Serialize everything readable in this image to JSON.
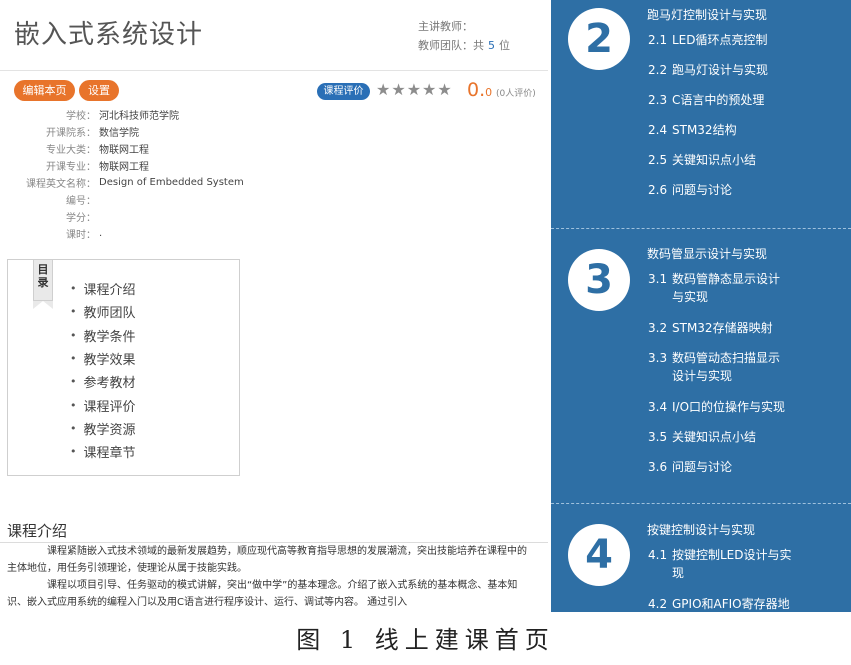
{
  "header": {
    "course_title": "嵌入式系统设计",
    "main_teacher_label": "主讲教师：",
    "team_label": "教师团队：共",
    "team_count": "5",
    "team_unit": "位"
  },
  "actions": {
    "edit_label": "编辑本页",
    "settings_label": "设置"
  },
  "rating": {
    "badge_label": "课程评价",
    "stars": "★★★★★",
    "score": "0.",
    "score_decimal": "0",
    "count_text": "(0人评价)",
    "star_color": "#8d8d8d",
    "score_color": "#e8742b"
  },
  "info": [
    {
      "key": "学校：",
      "value": "河北科技师范学院"
    },
    {
      "key": "开课院系：",
      "value": "数信学院"
    },
    {
      "key": "专业大类：",
      "value": "物联网工程"
    },
    {
      "key": "开课专业：",
      "value": "物联网工程"
    },
    {
      "key": "课程英文名称：",
      "value": "Design of Embedded System"
    },
    {
      "key": "编号：",
      "value": ""
    },
    {
      "key": "学分：",
      "value": ""
    },
    {
      "key": "课时：",
      "value": "."
    }
  ],
  "toc": {
    "ribbon": [
      "目",
      "录"
    ],
    "items": [
      "课程介绍",
      "教师团队",
      "教学条件",
      "教学效果",
      "参考教材",
      "课程评价",
      "教学资源",
      "课程章节"
    ]
  },
  "intro": {
    "heading": "课程介绍",
    "p1": "课程紧随嵌入式技术领域的最新发展趋势，顺应现代高等教育指导思想的发展潮流，突出技能培养在课程中的主体地位，用任务引领理论，使理论从属于技能实践。",
    "p2": "课程以项目引导、任务驱动的模式讲解，突出“做中学”的基本理念。介绍了嵌入式系统的基本概念、基本知识、嵌入式应用系统的编程入门以及用C语言进行程序设计、运行、调试等内容。 通过引入"
  },
  "chapters": [
    {
      "number": "2",
      "title": "跑马灯控制设计与实现",
      "sections": [
        {
          "no": "2.1",
          "t1": "LED循环点亮控制",
          "t2": ""
        },
        {
          "no": "2.2",
          "t1": "跑马灯设计与实现",
          "t2": ""
        },
        {
          "no": "2.3",
          "t1": "C语言中的预处理",
          "t2": ""
        },
        {
          "no": "2.4",
          "t1": "STM32结构",
          "t2": ""
        },
        {
          "no": "2.5",
          "t1": "关键知识点小结",
          "t2": ""
        },
        {
          "no": "2.6",
          "t1": "问题与讨论",
          "t2": ""
        }
      ]
    },
    {
      "number": "3",
      "title": "数码管显示设计与实现",
      "sections": [
        {
          "no": "3.1",
          "t1": "数码管静态显示设计",
          "t2": "与实现"
        },
        {
          "no": "3.2",
          "t1": "STM32存储器映射",
          "t2": ""
        },
        {
          "no": "3.3",
          "t1": "数码管动态扫描显示",
          "t2": "设计与实现"
        },
        {
          "no": "3.4",
          "t1": "I/O口的位操作与实现",
          "t2": ""
        },
        {
          "no": "3.5",
          "t1": "关键知识点小结",
          "t2": ""
        },
        {
          "no": "3.6",
          "t1": "问题与讨论",
          "t2": ""
        }
      ]
    },
    {
      "number": "4",
      "title": "按键控制设计与实现",
      "sections": [
        {
          "no": "4.1",
          "t1": "按键控制LED设计与实",
          "t2": "现"
        },
        {
          "no": "4.2",
          "t1": "GPIO和AFIO寄存器地",
          "t2": ""
        }
      ]
    }
  ],
  "colors": {
    "accent_orange": "#e8742b",
    "chapter_panel": "#2e6fa5",
    "badge_blue": "#2a6fb6"
  },
  "caption": "图 1  线上建课首页"
}
